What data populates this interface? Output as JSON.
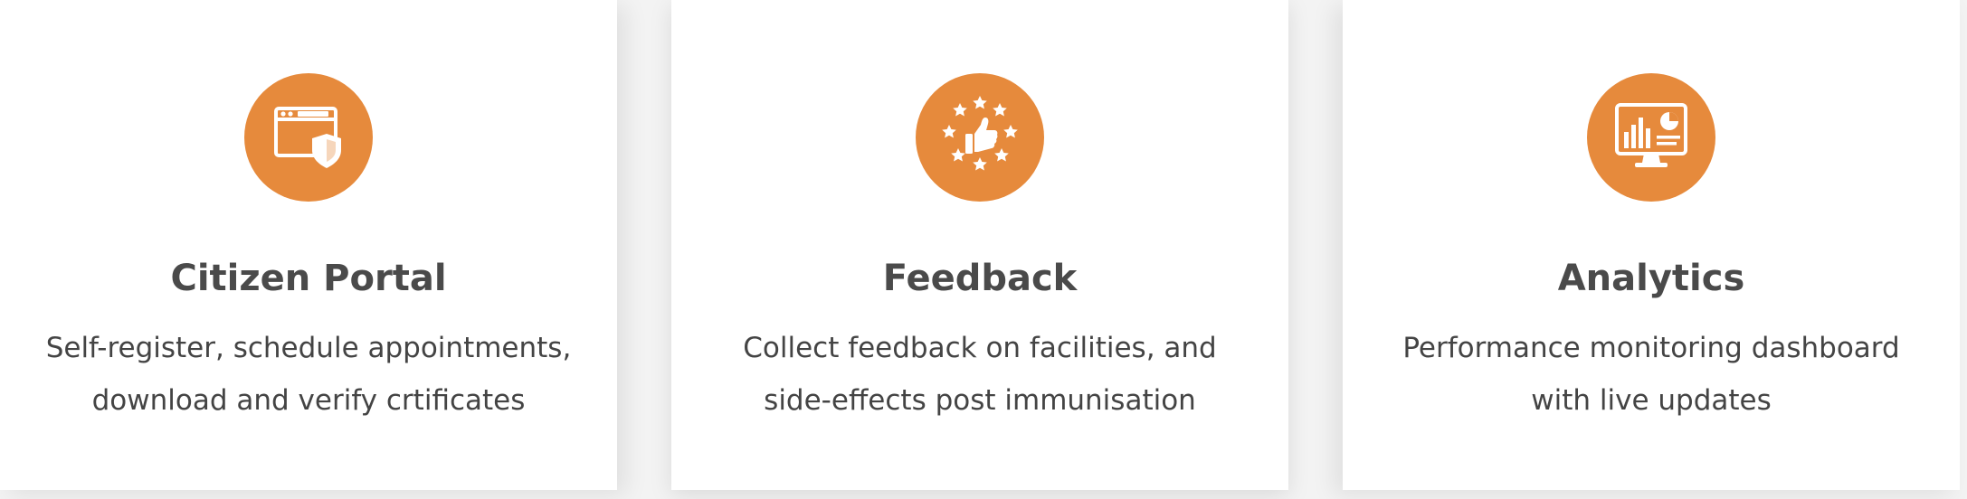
{
  "theme": {
    "accent": "#E68A3C",
    "title_color": "#4a4a4a",
    "text_color": "#444444"
  },
  "features": [
    {
      "icon": "browser-shield-icon",
      "title": "Citizen Portal",
      "description": "Self-register, schedule appointments, download and verify crtificates"
    },
    {
      "icon": "thumbs-up-stars-icon",
      "title": "Feedback",
      "description": "Collect feedback on facilities, and side-effects post immunisation"
    },
    {
      "icon": "monitor-chart-icon",
      "title": "Analytics",
      "description": "Performance monitoring dashboard with live updates"
    }
  ]
}
